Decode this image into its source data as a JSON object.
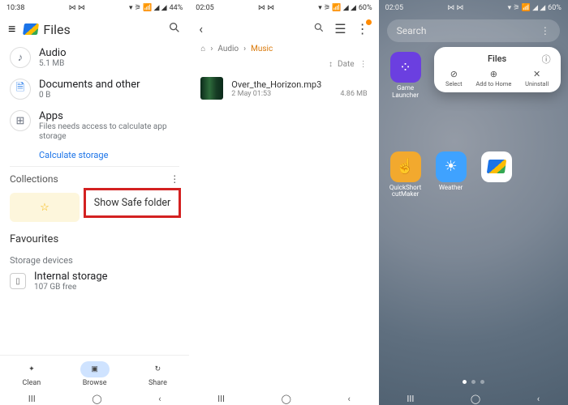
{
  "screen1": {
    "status": {
      "time": "10:38",
      "icons_left": "⋈ ⋈",
      "battery": "44%",
      "signal": "▾ ⚞ 📶 ◢ ◢"
    },
    "appbar": {
      "title": "Files"
    },
    "categories": [
      {
        "icon": "♪",
        "name": "Audio",
        "sub": "5.1 MB"
      },
      {
        "icon": "🗎",
        "name": "Documents and other",
        "sub": "0 B"
      },
      {
        "icon": "⊞",
        "name": "Apps",
        "sub": "Files needs access to calculate app storage"
      }
    ],
    "calc_link": "Calculate storage",
    "collections_label": "Collections",
    "safe_btn": "Show Safe folder",
    "favourites_label": "Favourites",
    "storage_label": "Storage devices",
    "internal": {
      "name": "Internal storage",
      "free": "107 GB free"
    },
    "nav": {
      "clean": "Clean",
      "browse": "Browse",
      "share": "Share"
    }
  },
  "screen2": {
    "status": {
      "time": "02:05",
      "icons_left": "⋈ ⋈",
      "battery": "60%",
      "signal": "▾ ⚞ 📶 ◢ ◢"
    },
    "breadcrumb": {
      "home": "⌂",
      "p1": "Audio",
      "current": "Music"
    },
    "sort": {
      "label": "Date"
    },
    "file": {
      "name": "Over_the_Horizon.mp3",
      "date": "2 May 01:53",
      "size": "4.86 MB"
    }
  },
  "screen3": {
    "status": {
      "time": "02:05",
      "icons_left": "⋈ ⋈",
      "battery": "60%",
      "signal": "▾ ⚞ 📶 ◢ ◢"
    },
    "search_placeholder": "Search",
    "apps_row1": [
      {
        "name": "Game Launcher",
        "bg": "#6b3fe0",
        "glyph": "⁘"
      }
    ],
    "apps_row2": [
      {
        "name": "QuickShort cutMaker",
        "bg": "#f2a92e",
        "glyph": "☝"
      },
      {
        "name": "Weather",
        "bg": "#3fa2ff",
        "glyph": "☀"
      },
      {
        "name": "",
        "bg": "#ffffff",
        "glyph": ""
      }
    ],
    "popup": {
      "title": "Files",
      "actions": [
        {
          "label": "Select",
          "glyph": "⊘"
        },
        {
          "label": "Add to Home",
          "glyph": "⊕"
        },
        {
          "label": "Uninstall",
          "glyph": "✕"
        }
      ]
    }
  }
}
